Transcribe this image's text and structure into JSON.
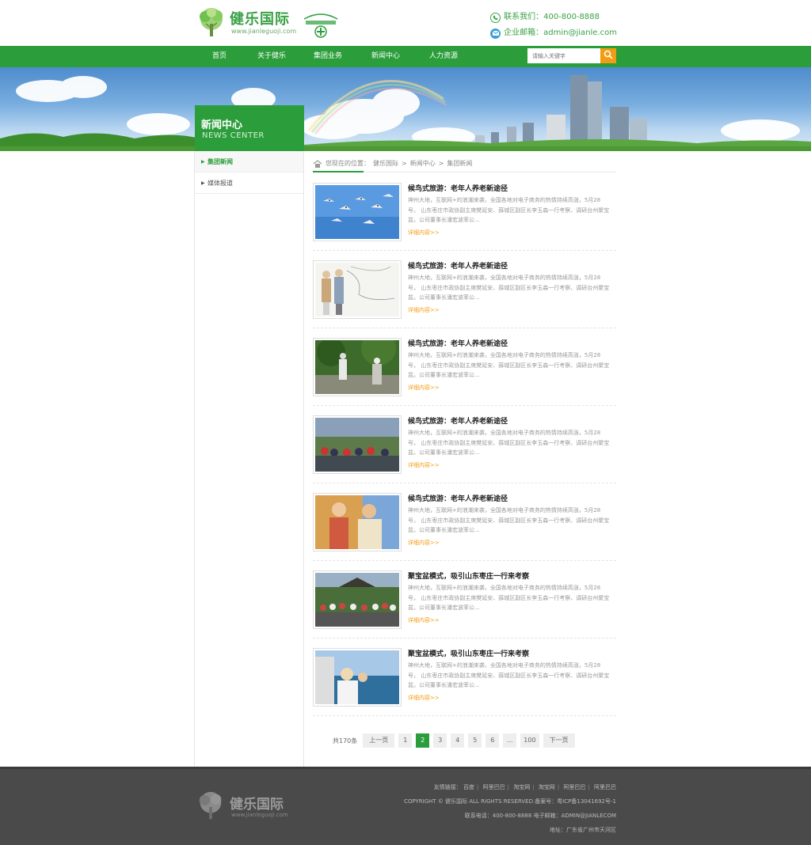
{
  "header": {
    "logo_name": "健乐国际",
    "logo_url": "www.jianleguoji.com",
    "phone_label": "联系我们：400-800-8888",
    "email_label": "企业邮箱：admin@jianle.com"
  },
  "nav": {
    "items": [
      {
        "label": "首页"
      },
      {
        "label": "关于健乐"
      },
      {
        "label": "集团业务"
      },
      {
        "label": "新闻中心"
      },
      {
        "label": "人力资源"
      }
    ],
    "search_placeholder": "请输入关键字"
  },
  "section": {
    "title": "新闻中心",
    "subtitle": "NEWS CENTER"
  },
  "sidebar": {
    "items": [
      {
        "label": "集团新闻"
      },
      {
        "label": "媒体报道"
      }
    ]
  },
  "breadcrumb": {
    "prefix": "您现在的位置：",
    "crumbs": [
      "健乐国际",
      "新闻中心",
      "集团新闻"
    ],
    "separator": ">"
  },
  "news": [
    {
      "title": "候鸟式旅游：老年人养老新途径",
      "desc": "神州大地，互联网+的浪潮来袭，全国各地对电子商务的热情持续高涨，5月28号， 山东枣庄市政协副主席樊延安、薛城区副区长李玉森一行考察、调研台州聚宝盆。公司董事长潘宏波率公...",
      "more": "详细内容>>"
    },
    {
      "title": "候鸟式旅游：老年人养老新途径",
      "desc": "神州大地，互联网+的浪潮来袭，全国各地对电子商务的热情持续高涨，5月28号， 山东枣庄市政协副主席樊延安、薛城区副区长李玉森一行考察、调研台州聚宝盆。公司董事长潘宏波率公...",
      "more": "详细内容>>"
    },
    {
      "title": "候鸟式旅游：老年人养老新途径",
      "desc": "神州大地，互联网+的浪潮来袭，全国各地对电子商务的热情持续高涨，5月28号， 山东枣庄市政协副主席樊延安、薛城区副区长李玉森一行考察、调研台州聚宝盆。公司董事长潘宏波率公...",
      "more": "详细内容>>"
    },
    {
      "title": "候鸟式旅游：老年人养老新途径",
      "desc": "神州大地，互联网+的浪潮来袭，全国各地对电子商务的热情持续高涨，5月28号， 山东枣庄市政协副主席樊延安、薛城区副区长李玉森一行考察、调研台州聚宝盆。公司董事长潘宏波率公...",
      "more": "详细内容>>"
    },
    {
      "title": "候鸟式旅游：老年人养老新途径",
      "desc": "神州大地，互联网+的浪潮来袭，全国各地对电子商务的热情持续高涨，5月28号， 山东枣庄市政协副主席樊延安、薛城区副区长李玉森一行考察、调研台州聚宝盆。公司董事长潘宏波率公...",
      "more": "详细内容>>"
    },
    {
      "title": "聚宝盆模式，吸引山东枣庄一行来考察",
      "desc": "神州大地，互联网+的浪潮来袭，全国各地对电子商务的热情持续高涨，5月28号， 山东枣庄市政协副主席樊延安、薛城区副区长李玉森一行考察、调研台州聚宝盆。公司董事长潘宏波率公...",
      "more": "详细内容>>"
    },
    {
      "title": "聚宝盆模式，吸引山东枣庄一行来考察",
      "desc": "神州大地，互联网+的浪潮来袭，全国各地对电子商务的热情持续高涨，5月28号， 山东枣庄市政协副主席樊延安、薛城区副区长李玉森一行考察、调研台州聚宝盆。公司董事长潘宏波率公...",
      "more": "详细内容>>"
    }
  ],
  "pagination": {
    "total": "共170条",
    "prev": "上一页",
    "pages": [
      "1",
      "2",
      "3",
      "4",
      "5",
      "6",
      "...",
      "100"
    ],
    "current": "2",
    "next": "下一页"
  },
  "footer": {
    "logo_name": "健乐国际",
    "logo_url": "www.jianleguoji.com",
    "links_label": "友情链接：",
    "links": [
      "百度",
      "阿里巴巴",
      "淘宝网",
      "淘宝网",
      "阿里巴巴",
      "阿里巴巴"
    ],
    "copyright": "COPYRIGHT © 健乐国际  ALL RIGHTS RESERVED.备案号：粤ICP备13041692号-1",
    "contact": "联系电话：400-800-8888 电子邮箱：ADMIN@JIANLECOM",
    "address": "地址：广东省广州市天河区"
  },
  "colors": {
    "brand_green": "#2b9e3b",
    "accent_orange": "#f39c12",
    "footer_bg": "#4a4a4a"
  },
  "icons": [
    "tree-logo-icon",
    "phone-icon",
    "mail-icon",
    "search-icon",
    "home-icon",
    "arrow-icon"
  ]
}
